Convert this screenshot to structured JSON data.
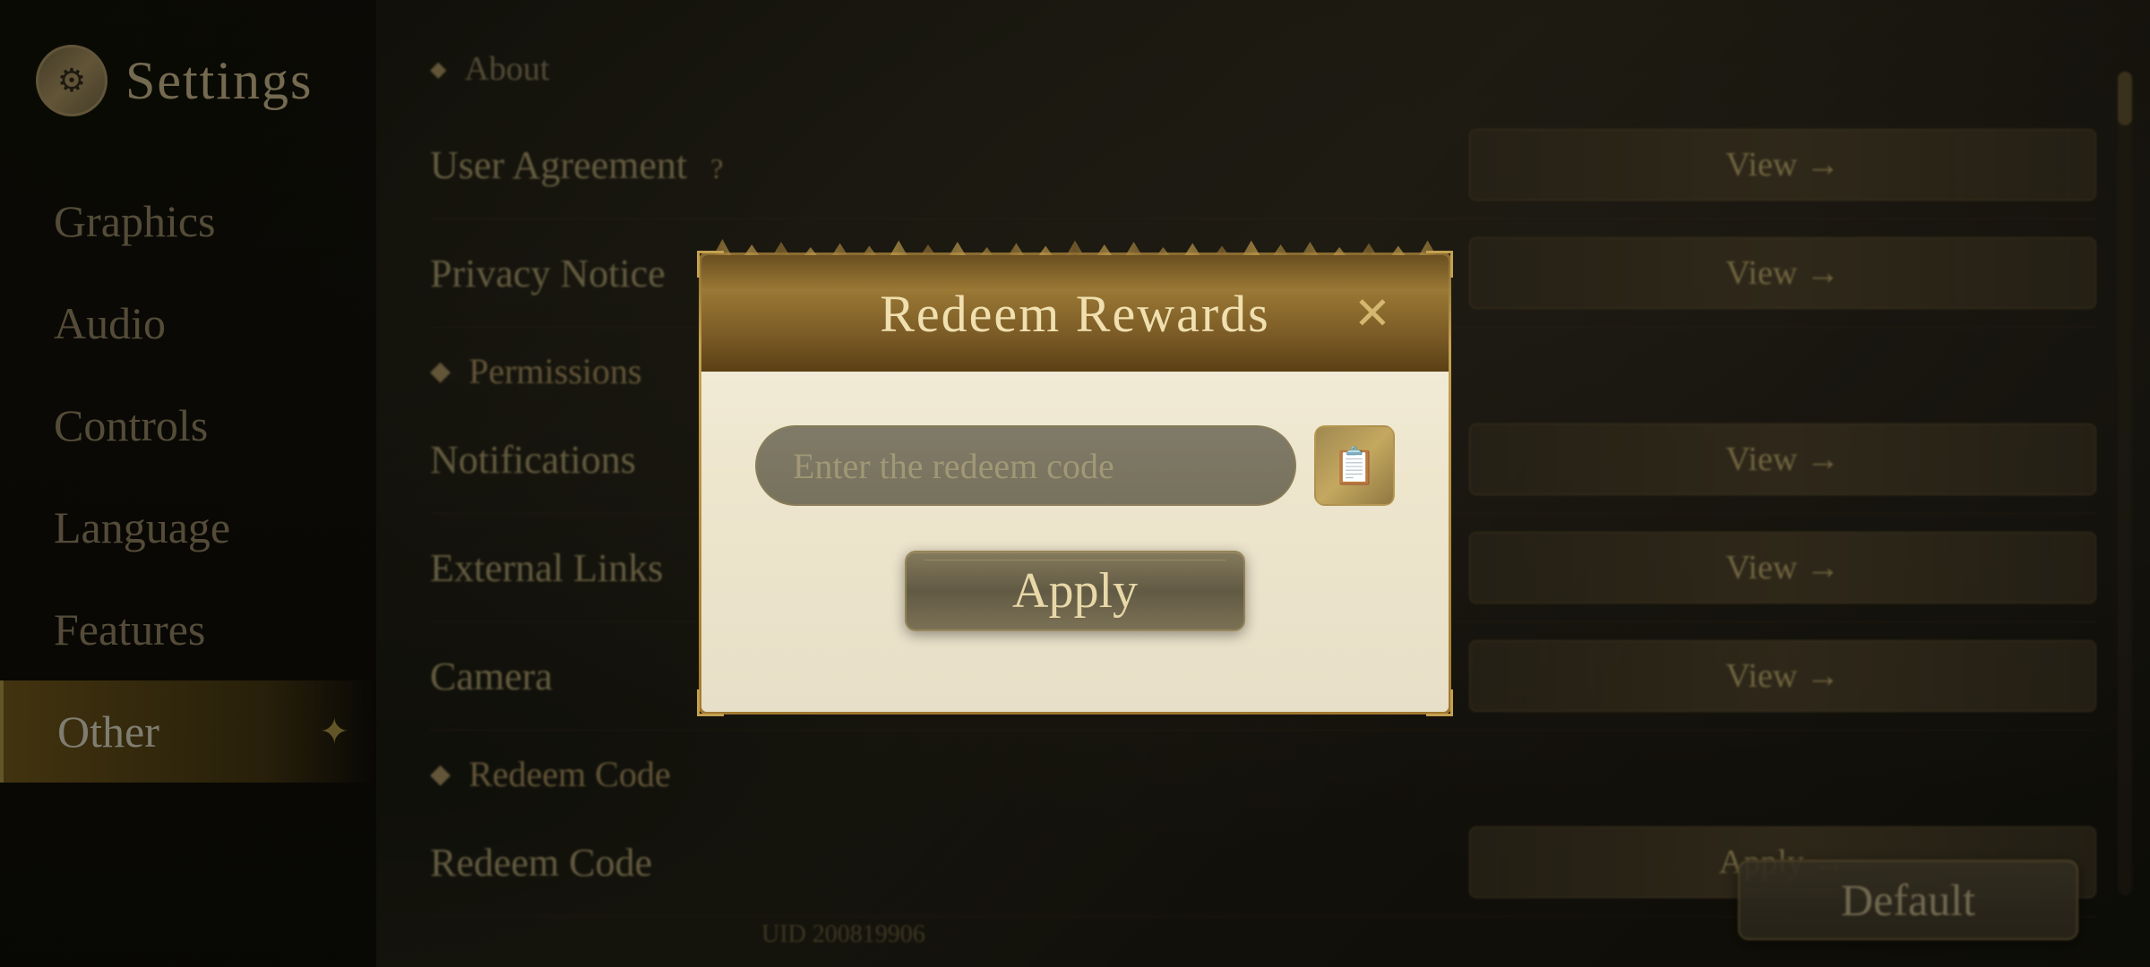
{
  "app": {
    "title": "Settings",
    "uid": "UID 200819906"
  },
  "sidebar": {
    "items": [
      {
        "id": "graphics",
        "label": "Graphics",
        "active": false
      },
      {
        "id": "audio",
        "label": "Audio",
        "active": false
      },
      {
        "id": "controls",
        "label": "Controls",
        "active": false
      },
      {
        "id": "language",
        "label": "Language",
        "active": false
      },
      {
        "id": "features",
        "label": "Features",
        "active": false
      },
      {
        "id": "other",
        "label": "Other",
        "active": true
      }
    ]
  },
  "main": {
    "sections": [
      {
        "type": "about-header",
        "label": "About"
      },
      {
        "label": "User Agreement",
        "badge": "?",
        "action": "View →"
      },
      {
        "label": "Privacy Notice",
        "action": "View →"
      },
      {
        "type": "section-header",
        "label": "Permissions"
      },
      {
        "label": "Notifications",
        "action": "View →"
      },
      {
        "label": "External Links",
        "action": "View →"
      },
      {
        "label": "Camera",
        "action": "View →"
      },
      {
        "type": "section-header",
        "label": "Redeem Code"
      },
      {
        "label": "Redeem Code",
        "action": "Apply →"
      }
    ],
    "default_button": "Default"
  },
  "modal": {
    "title": "Redeem Rewards",
    "close_icon": "✕",
    "input_placeholder": "Enter the redeem code",
    "paste_icon": "📋",
    "apply_button": "Apply"
  },
  "colors": {
    "gold": "#c4aa70",
    "dark_bg": "#1a1a10",
    "text_light": "#e8d4a0"
  }
}
